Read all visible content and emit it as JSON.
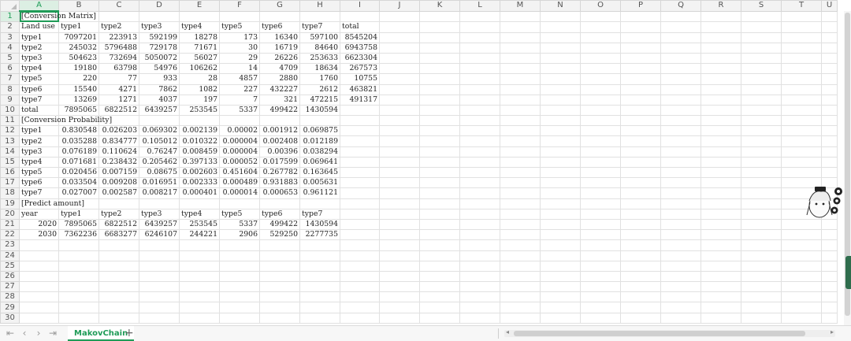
{
  "columns": [
    "A",
    "B",
    "C",
    "D",
    "E",
    "F",
    "G",
    "H",
    "I",
    "J",
    "K",
    "L",
    "M",
    "N",
    "O",
    "P",
    "Q",
    "R",
    "S",
    "T",
    "U"
  ],
  "selected_cell": "A1",
  "rows": [
    {
      "n": "1",
      "cells": [
        "[Conversion Matrix]",
        "",
        "",
        "",
        "",
        "",
        "",
        "",
        ""
      ]
    },
    {
      "n": "2",
      "cells": [
        "Land use",
        "type1",
        "type2",
        "type3",
        "type4",
        "type5",
        "type6",
        "type7",
        "total"
      ]
    },
    {
      "n": "3",
      "cells": [
        "type1",
        "7097201",
        "223913",
        "592199",
        "18278",
        "173",
        "16340",
        "597100",
        "8545204"
      ]
    },
    {
      "n": "4",
      "cells": [
        "type2",
        "245032",
        "5796488",
        "729178",
        "71671",
        "30",
        "16719",
        "84640",
        "6943758"
      ]
    },
    {
      "n": "5",
      "cells": [
        "type3",
        "504623",
        "732694",
        "5050072",
        "56027",
        "29",
        "26226",
        "253633",
        "6623304"
      ]
    },
    {
      "n": "6",
      "cells": [
        "type4",
        "19180",
        "63798",
        "54976",
        "106262",
        "14",
        "4709",
        "18634",
        "267573"
      ]
    },
    {
      "n": "7",
      "cells": [
        "type5",
        "220",
        "77",
        "933",
        "28",
        "4857",
        "2880",
        "1760",
        "10755"
      ]
    },
    {
      "n": "8",
      "cells": [
        "type6",
        "15540",
        "4271",
        "7862",
        "1082",
        "227",
        "432227",
        "2612",
        "463821"
      ]
    },
    {
      "n": "9",
      "cells": [
        "type7",
        "13269",
        "1271",
        "4037",
        "197",
        "7",
        "321",
        "472215",
        "491317"
      ]
    },
    {
      "n": "10",
      "cells": [
        "total",
        "7895065",
        "6822512",
        "6439257",
        "253545",
        "5337",
        "499422",
        "1430594",
        ""
      ]
    },
    {
      "n": "11",
      "cells": [
        "[Conversion Probability]",
        "",
        "",
        "",
        "",
        "",
        "",
        "",
        ""
      ]
    },
    {
      "n": "12",
      "cells": [
        "type1",
        "0.830548",
        "0.026203",
        "0.069302",
        "0.002139",
        "0.00002",
        "0.001912",
        "0.069875",
        ""
      ]
    },
    {
      "n": "13",
      "cells": [
        "type2",
        "0.035288",
        "0.834777",
        "0.105012",
        "0.010322",
        "0.000004",
        "0.002408",
        "0.012189",
        ""
      ]
    },
    {
      "n": "14",
      "cells": [
        "type3",
        "0.076189",
        "0.110624",
        "0.76247",
        "0.008459",
        "0.000004",
        "0.00396",
        "0.038294",
        ""
      ]
    },
    {
      "n": "15",
      "cells": [
        "type4",
        "0.071681",
        "0.238432",
        "0.205462",
        "0.397133",
        "0.000052",
        "0.017599",
        "0.069641",
        ""
      ]
    },
    {
      "n": "16",
      "cells": [
        "type5",
        "0.020456",
        "0.007159",
        "0.08675",
        "0.002603",
        "0.451604",
        "0.267782",
        "0.163645",
        ""
      ]
    },
    {
      "n": "17",
      "cells": [
        "type6",
        "0.033504",
        "0.009208",
        "0.016951",
        "0.002333",
        "0.000489",
        "0.931883",
        "0.005631",
        ""
      ]
    },
    {
      "n": "18",
      "cells": [
        "type7",
        "0.027007",
        "0.002587",
        "0.008217",
        "0.000401",
        "0.000014",
        "0.000653",
        "0.961121",
        ""
      ]
    },
    {
      "n": "19",
      "cells": [
        "[Predict amount]",
        "",
        "",
        "",
        "",
        "",
        "",
        "",
        ""
      ]
    },
    {
      "n": "20",
      "cells": [
        "year",
        "type1",
        "type2",
        "type3",
        "type4",
        "type5",
        "type6",
        "type7",
        ""
      ]
    },
    {
      "n": "21",
      "cells": [
        "2020",
        "7895065",
        "6822512",
        "6439257",
        "253545",
        "5337",
        "499422",
        "1430594",
        ""
      ]
    },
    {
      "n": "22",
      "cells": [
        "2030",
        "7362236",
        "6683277",
        "6246107",
        "244221",
        "2906",
        "529250",
        "2277735",
        ""
      ]
    },
    {
      "n": "23",
      "cells": [
        "",
        "",
        "",
        "",
        "",
        "",
        "",
        "",
        ""
      ]
    },
    {
      "n": "24",
      "cells": [
        "",
        "",
        "",
        "",
        "",
        "",
        "",
        "",
        ""
      ]
    },
    {
      "n": "25",
      "cells": [
        "",
        "",
        "",
        "",
        "",
        "",
        "",
        "",
        ""
      ]
    },
    {
      "n": "26",
      "cells": [
        "",
        "",
        "",
        "",
        "",
        "",
        "",
        "",
        ""
      ]
    },
    {
      "n": "27",
      "cells": [
        "",
        "",
        "",
        "",
        "",
        "",
        "",
        "",
        ""
      ]
    },
    {
      "n": "28",
      "cells": [
        "",
        "",
        "",
        "",
        "",
        "",
        "",
        "",
        ""
      ]
    },
    {
      "n": "29",
      "cells": [
        "",
        "",
        "",
        "",
        "",
        "",
        "",
        "",
        ""
      ]
    },
    {
      "n": "30",
      "cells": [
        "",
        "",
        "",
        "",
        "",
        "",
        "",
        "",
        ""
      ]
    }
  ],
  "sheet_tab": "MakovChain",
  "add_tab_label": "+",
  "nav_icons": [
    "first-sheet-icon",
    "prev-sheet-icon",
    "next-sheet-icon",
    "last-sheet-icon"
  ],
  "accent_color": "#1f9b57"
}
